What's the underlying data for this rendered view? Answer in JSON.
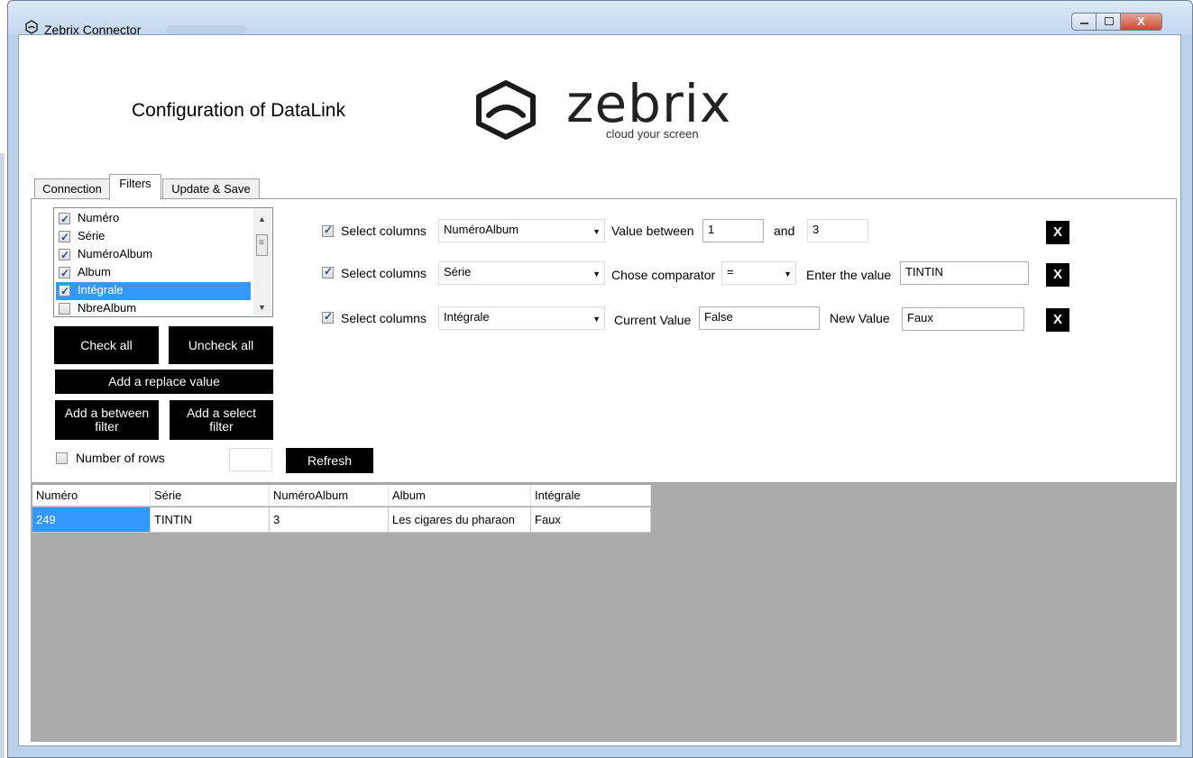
{
  "window": {
    "title": "Zebrix Connector",
    "close_label": "X"
  },
  "header": {
    "heading": "Configuration of DataLink",
    "logo_text": "zebrix",
    "logo_tagline": "cloud your screen"
  },
  "tabs": [
    {
      "label": "Connection",
      "active": false
    },
    {
      "label": "Filters",
      "active": true
    },
    {
      "label": "Update & Save",
      "active": false
    }
  ],
  "column_list": [
    {
      "label": "Numéro",
      "checked": true,
      "selected": false
    },
    {
      "label": "Série",
      "checked": true,
      "selected": false
    },
    {
      "label": "NuméroAlbum",
      "checked": true,
      "selected": false
    },
    {
      "label": "Album",
      "checked": true,
      "selected": false
    },
    {
      "label": "Intégrale",
      "checked": true,
      "selected": true
    },
    {
      "label": "NbreAlbum",
      "checked": false,
      "selected": false
    }
  ],
  "buttons": {
    "check_all": "Check all",
    "uncheck_all": "Uncheck all",
    "add_replace": "Add a replace value",
    "add_between": "Add a between filter",
    "add_select": "Add a select filter",
    "refresh": "Refresh"
  },
  "rows_option": {
    "label": "Number of rows",
    "checked": false,
    "value": ""
  },
  "filters": [
    {
      "checked": true,
      "select_label": "Select columns",
      "column": "NuméroAlbum",
      "label1": "Value between",
      "value1": "1",
      "label2": "and",
      "value2": "3",
      "remove": "X"
    },
    {
      "checked": true,
      "select_label": "Select columns",
      "column": "Série",
      "label1": "Chose comparator",
      "comparator": "=",
      "label2": "Enter the value",
      "value2": "TINTIN",
      "remove": "X"
    },
    {
      "checked": true,
      "select_label": "Select columns",
      "column": "Intégrale",
      "label1": "Current Value",
      "value1": "False",
      "label2": "New Value",
      "value2": "Faux",
      "remove": "X"
    }
  ],
  "grid": {
    "columns": [
      "Numéro",
      "Série",
      "NuméroAlbum",
      "Album",
      "Intégrale"
    ],
    "rows": [
      [
        "249",
        "TINTIN",
        "3",
        "Les cigares du pharaon",
        "Faux"
      ]
    ]
  }
}
